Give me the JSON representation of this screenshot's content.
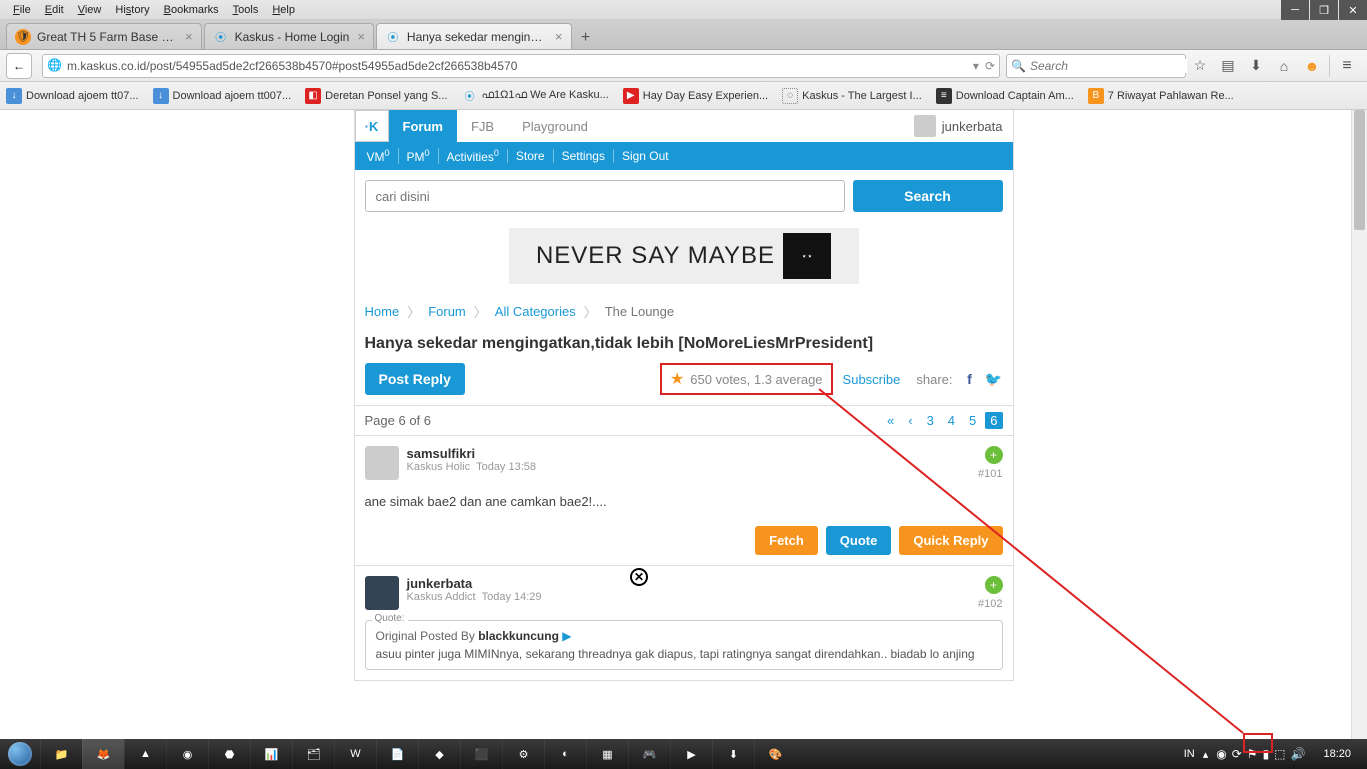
{
  "menubar": [
    "File",
    "Edit",
    "View",
    "History",
    "Bookmarks",
    "Tools",
    "Help"
  ],
  "tabs": [
    {
      "title": "Great TH 5 Farm Base base ...",
      "active": false
    },
    {
      "title": "Kaskus - Home Login",
      "active": false
    },
    {
      "title": "Hanya sekedar mengingat...",
      "active": true
    }
  ],
  "url": "m.kaskus.co.id/post/54955ad5de2cf266538b4570#post54955ad5de2cf266538b4570",
  "searchbox_placeholder": "Search",
  "bookmarks": [
    "Download ajoem tt07...",
    "Download ajoem tt007...",
    "Deretan Ponsel yang S...",
    "ഫ1Ω1ഫ We Are Kasku...",
    "Hay Day Easy Experien...",
    "Kaskus - The Largest I...",
    "Download Captain Am...",
    "7 Riwayat Pahlawan Re..."
  ],
  "kaskus": {
    "nav": {
      "forum": "Forum",
      "fjb": "FJB",
      "playground": "Playground"
    },
    "user": "junkerbata",
    "sub": {
      "vm": "VM",
      "vm_sup": "0",
      "pm": "PM",
      "pm_sup": "0",
      "activities": "Activities",
      "act_sup": "0",
      "store": "Store",
      "settings": "Settings",
      "signout": "Sign Out"
    },
    "search_placeholder": "cari disini",
    "search_btn": "Search",
    "banner": "NEVER SAY MAYBE",
    "breadcrumbs": {
      "home": "Home",
      "forum": "Forum",
      "all": "All Categories",
      "cur": "The Lounge"
    },
    "thread_title": "Hanya sekedar mengingatkan,tidak lebih [NoMoreLiesMrPresident]",
    "post_reply": "Post Reply",
    "rating": "650 votes, 1.3 average",
    "subscribe": "Subscribe",
    "share_label": "share:",
    "page_info": "Page 6 of 6",
    "pages": [
      "«",
      "‹",
      "3",
      "4",
      "5",
      "6"
    ],
    "current_page": "6",
    "posts": [
      {
        "user": "samsulfikri",
        "rank": "Kaskus Holic",
        "time": "Today 13:58",
        "num": "#101",
        "body": "ane simak bae2 dan ane camkan bae2!....",
        "actions": [
          "Fetch",
          "Quote",
          "Quick Reply"
        ]
      },
      {
        "user": "junkerbata",
        "rank": "Kaskus Addict",
        "time": "Today 14:29",
        "num": "#102",
        "quote_label": "Quote:",
        "quote_author_prefix": "Original Posted By ",
        "quote_author": "blackkuncung",
        "quote_text": "asuu pinter juga MIMINnya, sekarang threadnya gak diapus, tapi ratingnya sangat direndahkan.. biadab lo anjing"
      }
    ]
  },
  "taskbar": {
    "lang": "IN",
    "time": "18:20"
  }
}
